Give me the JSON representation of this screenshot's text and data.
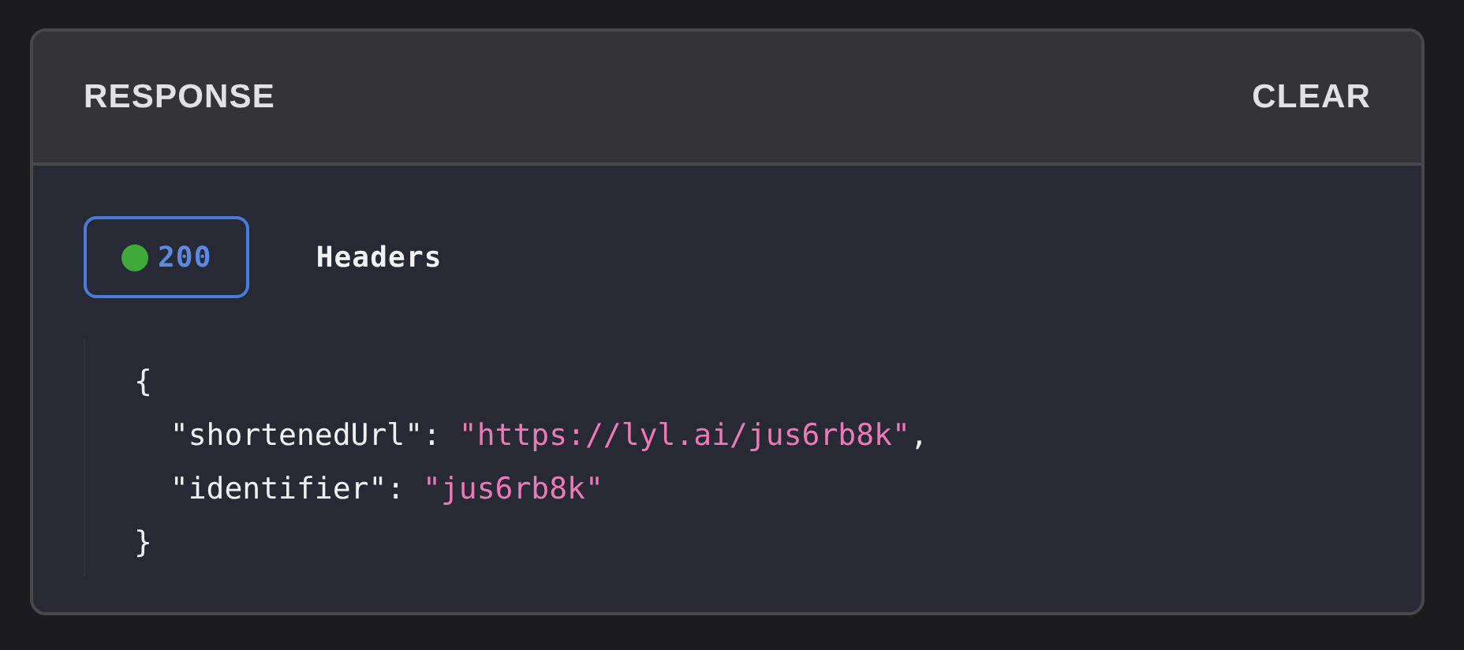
{
  "panel": {
    "title": "RESPONSE",
    "action": "CLEAR"
  },
  "tabs": [
    {
      "kind": "status",
      "label": "200",
      "color": "#3faa3a",
      "selected": true
    },
    {
      "kind": "plain",
      "label": "Headers",
      "selected": false
    }
  ],
  "code": {
    "lines": [
      [
        {
          "kind": "punct",
          "text": "{"
        }
      ],
      [
        {
          "kind": "key",
          "text": "  \"shortenedUrl\""
        },
        {
          "kind": "punct",
          "text": ": "
        },
        {
          "kind": "string",
          "text": "\"https://lyl.ai/jus6rb8k\""
        },
        {
          "kind": "punct",
          "text": ","
        }
      ],
      [
        {
          "kind": "key",
          "text": "  \"identifier\""
        },
        {
          "kind": "punct",
          "text": ": "
        },
        {
          "kind": "string",
          "text": "\"jus6rb8k\""
        }
      ],
      [
        {
          "kind": "punct",
          "text": "}"
        }
      ]
    ]
  }
}
